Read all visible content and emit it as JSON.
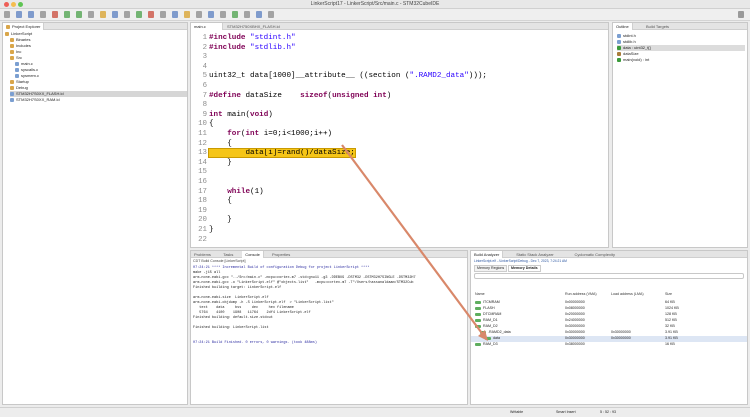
{
  "window": {
    "title": "LinkerScript17 - LinkerScript/Src/main.c - STM32CubeIDE"
  },
  "toolbar": {
    "quick_access": "Q"
  },
  "explorer": {
    "tab_label": "Project Explorer",
    "items": [
      {
        "label": "LinkerScript",
        "icon": "folder-icon"
      },
      {
        "label": "Binaries",
        "icon": "folder-icon"
      },
      {
        "label": "Includes",
        "icon": "folder-icon"
      },
      {
        "label": "Inc",
        "icon": "folder-icon"
      },
      {
        "label": "Src",
        "icon": "folder-icon"
      },
      {
        "label": "main.c",
        "icon": "c-file-icon"
      },
      {
        "label": "syscalls.c",
        "icon": "c-file-icon"
      },
      {
        "label": "sysmem.c",
        "icon": "c-file-icon"
      },
      {
        "label": "Startup",
        "icon": "folder-icon"
      },
      {
        "label": "Debug",
        "icon": "folder-icon"
      },
      {
        "label": "STM32H7S0XX_FLASH.ld",
        "icon": "ld-file-icon"
      },
      {
        "label": "STM32H7S0XX_RAM.ld",
        "icon": "ld-file-icon"
      }
    ]
  },
  "editor": {
    "tabs": [
      {
        "label": "main.c"
      },
      {
        "label": "STM32H750XBHX_FLASH.ld"
      }
    ],
    "lines": [
      {
        "num": "1",
        "parts": [
          {
            "t": "#include ",
            "c": "kw"
          },
          {
            "t": "\"stdint.h\"",
            "c": "str"
          }
        ]
      },
      {
        "num": "2",
        "parts": [
          {
            "t": "#include ",
            "c": "kw"
          },
          {
            "t": "\"stdlib.h\"",
            "c": "str"
          }
        ]
      },
      {
        "num": "3",
        "parts": []
      },
      {
        "num": "4",
        "parts": []
      },
      {
        "num": "5",
        "parts": [
          {
            "t": "uint32_t data[1000]__attribute__ ((section (",
            "c": ""
          },
          {
            "t": "\".RAMD2_data\"",
            "c": "str"
          },
          {
            "t": ")));",
            "c": ""
          }
        ]
      },
      {
        "num": "6",
        "parts": []
      },
      {
        "num": "7",
        "parts": [
          {
            "t": "#define ",
            "c": "kw"
          },
          {
            "t": "dataSize    ",
            "c": ""
          },
          {
            "t": "sizeof",
            "c": "kw"
          },
          {
            "t": "(",
            "c": ""
          },
          {
            "t": "unsigned int",
            "c": "kw"
          },
          {
            "t": ")",
            "c": ""
          }
        ]
      },
      {
        "num": "8",
        "parts": []
      },
      {
        "num": "9",
        "parts": [
          {
            "t": "int ",
            "c": "kw"
          },
          {
            "t": "main",
            "c": ""
          },
          {
            "t": "(",
            "c": ""
          },
          {
            "t": "void",
            "c": "kw"
          },
          {
            "t": ")",
            "c": ""
          }
        ]
      },
      {
        "num": "10",
        "parts": [
          {
            "t": "{",
            "c": ""
          }
        ]
      },
      {
        "num": "11",
        "parts": [
          {
            "t": "    ",
            "c": ""
          },
          {
            "t": "for",
            "c": "kw"
          },
          {
            "t": "(",
            "c": ""
          },
          {
            "t": "int ",
            "c": "kw"
          },
          {
            "t": "i=0;i<1000;i++)",
            "c": ""
          }
        ]
      },
      {
        "num": "12",
        "parts": [
          {
            "t": "    {",
            "c": ""
          }
        ]
      },
      {
        "num": "13",
        "parts": [
          {
            "t": "        data[i]=rand()/dataSize;",
            "c": "hl"
          }
        ]
      },
      {
        "num": "14",
        "parts": [
          {
            "t": "    }",
            "c": ""
          }
        ]
      },
      {
        "num": "15",
        "parts": []
      },
      {
        "num": "16",
        "parts": []
      },
      {
        "num": "17",
        "parts": [
          {
            "t": "    ",
            "c": ""
          },
          {
            "t": "while",
            "c": "kw"
          },
          {
            "t": "(1)",
            "c": ""
          }
        ]
      },
      {
        "num": "18",
        "parts": [
          {
            "t": "    {",
            "c": ""
          }
        ]
      },
      {
        "num": "19",
        "parts": []
      },
      {
        "num": "20",
        "parts": [
          {
            "t": "    }",
            "c": ""
          }
        ]
      },
      {
        "num": "21",
        "parts": [
          {
            "t": "}",
            "c": ""
          }
        ]
      },
      {
        "num": "22",
        "parts": []
      }
    ]
  },
  "outline": {
    "tabs": [
      {
        "label": "Outline"
      },
      {
        "label": "Build Targets"
      }
    ],
    "items": [
      {
        "label": "stdint.h",
        "color": "#7b9fd1"
      },
      {
        "label": "stdlib.h",
        "color": "#7b9fd1"
      },
      {
        "label": "data : uint32_t[]",
        "color": "#3a9a3a"
      },
      {
        "label": "dataSize",
        "color": "#a97c3a"
      },
      {
        "label": "main(void) : int",
        "color": "#3a9a3a"
      }
    ]
  },
  "console": {
    "tabs": [
      {
        "label": "Problems"
      },
      {
        "label": "Tasks"
      },
      {
        "label": "Console"
      },
      {
        "label": "Properties"
      }
    ],
    "header": "CDT Build Console [LinkerScript]",
    "lines": [
      {
        "t": "07:24:21 **** Incremental Build of configuration Debug for project LinkerScript ****",
        "c": "#2a2aa0"
      },
      {
        "t": "make -j15 all",
        "c": ""
      },
      {
        "t": "arm-none-eabi-gcc \"../Src/main.c\" -mcpu=cortex-m7 -std=gnu11 -g3 -DDEBUG -DSTM32 -DSTM32H7SINGLE -DSTM32H7",
        "c": ""
      },
      {
        "t": "arm-none-eabi-gcc -o \"LinkerScript.elf\" @\"objects.list\"   -mcpu=cortex-m7 -T\"/Users/hassanaldaam/STM32Cub",
        "c": ""
      },
      {
        "t": "Finished building target: LinkerScript.elf",
        "c": ""
      },
      {
        "t": "",
        "c": ""
      },
      {
        "t": "arm-none-eabi-size  LinkerScript.elf",
        "c": ""
      },
      {
        "t": "arm-none-eabi-objdump -h -S LinkerScript.elf  > \"LinkerScript.list\"",
        "c": ""
      },
      {
        "t": "   text    data     bss     dec     hex filename",
        "c": ""
      },
      {
        "t": "   5764    4100    1908   11764    2df4 LinkerScript.elf",
        "c": ""
      },
      {
        "t": "Finished building: default.size.stdout",
        "c": ""
      },
      {
        "t": "",
        "c": ""
      },
      {
        "t": "Finished building: LinkerScript.list",
        "c": ""
      },
      {
        "t": "",
        "c": ""
      },
      {
        "t": "",
        "c": ""
      },
      {
        "t": "07:24:21 Build Finished. 0 errors, 0 warnings. (took 488ms)",
        "c": "#2a2aa0"
      }
    ]
  },
  "build_analyzer": {
    "tabs": [
      {
        "label": "Build Analyzer"
      },
      {
        "label": "Static Stack Analyzer"
      },
      {
        "label": "Cyclomatic Complexity"
      }
    ],
    "file_info": "LinkerScript.elf - /LinkerScript/Debug - Dec 7, 2023, 7:24:21 AM",
    "subtabs": [
      {
        "label": "Memory Regions"
      },
      {
        "label": "Memory Details"
      }
    ],
    "search_placeholder": "",
    "columns": [
      "Name",
      "Run address (VMA)",
      "Load address (LMA)",
      "Size"
    ],
    "rows": [
      {
        "name": "ITCMRAM",
        "vma": "0x00000000",
        "lma": "",
        "size": "64 KB",
        "indent": 0
      },
      {
        "name": "FLASH",
        "vma": "0x08000000",
        "lma": "",
        "size": "1024 KB",
        "indent": 0
      },
      {
        "name": "DTCMRAM",
        "vma": "0x20000000",
        "lma": "",
        "size": "128 KB",
        "indent": 0
      },
      {
        "name": "RAM_D1",
        "vma": "0x24000000",
        "lma": "",
        "size": "512 KB",
        "indent": 0
      },
      {
        "name": "RAM_D2",
        "vma": "0x30000000",
        "lma": "",
        "size": "32 KB",
        "indent": 0
      },
      {
        "name": ".RAMD2_data",
        "vma": "0x30000000",
        "lma": "0x30000000",
        "size": "3.91 KB",
        "indent": 1
      },
      {
        "name": "data",
        "vma": "0x30000000",
        "lma": "0x30000000",
        "size": "3.91 KB",
        "indent": 2
      },
      {
        "name": "RAM_D3",
        "vma": "0x38000000",
        "lma": "",
        "size": "16 KB",
        "indent": 0
      }
    ]
  },
  "status": {
    "mode": "Writable",
    "insert": "Smart Insert",
    "position": "5 : 52 : 93"
  },
  "colors": {
    "highlight": "#f5c518",
    "arrow": "#d9886a"
  }
}
